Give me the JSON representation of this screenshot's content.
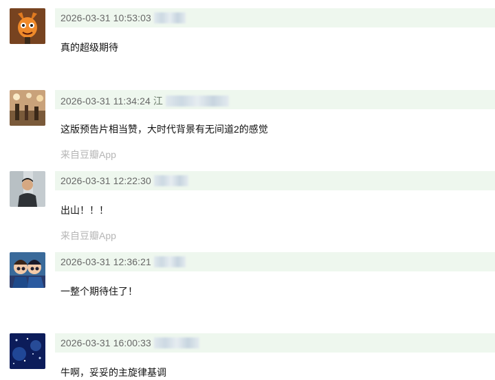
{
  "comments": [
    {
      "time": "2026-03-31 10:53:03",
      "user_fragment": "",
      "content": "真的超级期待",
      "source": ""
    },
    {
      "time": "2026-03-31 11:34:24",
      "user_fragment": "江",
      "content": "这版预告片相当赞，大时代背景有无间道2的感觉",
      "source": "来自豆瓣App"
    },
    {
      "time": "2026-03-31 12:22:30",
      "user_fragment": "",
      "content": "出山！！！",
      "source": "来自豆瓣App"
    },
    {
      "time": "2026-03-31 12:36:21",
      "user_fragment": "",
      "content": "一整个期待住了！",
      "source": ""
    },
    {
      "time": "2026-03-31 16:00:33",
      "user_fragment": "",
      "content": "牛啊，妥妥的主旋律基调",
      "source": ""
    }
  ],
  "colors": {
    "header_bg": "#eef7ee",
    "meta_text": "#666666",
    "source_text": "#b5b5b5"
  }
}
